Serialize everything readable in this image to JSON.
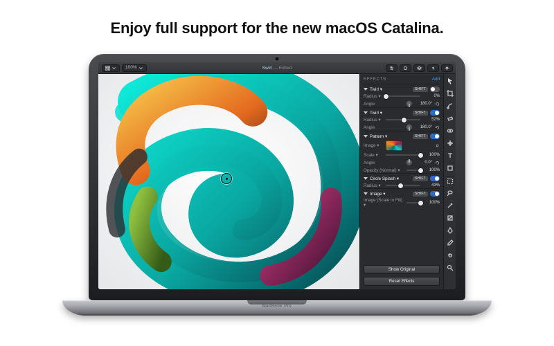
{
  "headline": "Enjoy full support for the new macOS Catalina.",
  "device_label": "MacBook Pro",
  "toolbar": {
    "zoom": "100%",
    "document_name": "Swirl",
    "document_state": "Edited"
  },
  "inspector": {
    "header_label": "EFFECTS",
    "add_label": "Add",
    "buttons": {
      "show_original": "Show Original",
      "reset_effects": "Reset Effects"
    }
  },
  "effects": [
    {
      "name": "Twirl",
      "chip": "SHIFT",
      "enabled": false,
      "rows": [
        {
          "kind": "slider",
          "label": "Radius",
          "value": "0%",
          "pos": 0
        },
        {
          "kind": "dial",
          "label": "Angle",
          "value": "180.0°",
          "dial": "d180"
        }
      ]
    },
    {
      "name": "Twirl",
      "chip": "SHIFT",
      "enabled": true,
      "rows": [
        {
          "kind": "slider",
          "label": "Radius",
          "value": "52%",
          "pos": 52
        },
        {
          "kind": "dial",
          "label": "Angle",
          "value": "180.0°",
          "dial": "d180"
        }
      ]
    },
    {
      "name": "Pattern",
      "chip": "SHIFT",
      "enabled": true,
      "rows": [
        {
          "kind": "thumb",
          "label": "Image"
        },
        {
          "kind": "slider",
          "label": "Scale",
          "value": "100%",
          "pos": 100
        },
        {
          "kind": "dial",
          "label": "Angle",
          "value": "0.0°",
          "dial": "d0"
        },
        {
          "kind": "slider",
          "label": "Opacity (Normal)",
          "value": "100%",
          "pos": 100,
          "wide": true
        }
      ]
    },
    {
      "name": "Circle Splash",
      "chip": "SHIFT",
      "enabled": true,
      "rows": [
        {
          "kind": "slider",
          "label": "Radius",
          "value": "43%",
          "pos": 43
        }
      ]
    },
    {
      "name": "Image",
      "chip": "SHIFT",
      "enabled": true,
      "rows": [
        {
          "kind": "slider",
          "label": "Image (Scale to Fill)",
          "value": "100%",
          "pos": 100,
          "wide": true
        }
      ]
    }
  ]
}
